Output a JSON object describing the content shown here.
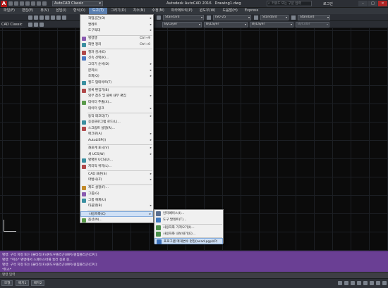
{
  "titlebar": {
    "workspace": "AutoCAD Classic",
    "app_name": "Autodesk AutoCAD 2016",
    "document": "Drawing1.dwg",
    "search_placeholder": "키워드 또는 구문 입력",
    "login": "로그인"
  },
  "menubar": [
    "파일(F)",
    "편집(E)",
    "뷰(V)",
    "삽입(I)",
    "형식(O)",
    "도구(T)",
    "그리기(D)",
    "치수(N)",
    "수정(M)",
    "파라메트릭(P)",
    "윈도우(W)",
    "도움말(H)",
    "Express"
  ],
  "toolbar": {
    "workspace_short": "CAD Classic",
    "text_style": "Standard",
    "dim_style": "ISO-25",
    "table_style": "Standard",
    "mleader_style": "Standard",
    "layer_color": "ByLayer",
    "linetype": "ByLayer",
    "lineweight": "ByLayer",
    "plot_style": "ByColor"
  },
  "tools_menu": {
    "items": [
      {
        "label": "작업공간(O)",
        "shortcut": "",
        "arrow": true,
        "icon": "none"
      },
      {
        "label": "팔레트",
        "shortcut": "",
        "arrow": true,
        "icon": "none"
      },
      {
        "label": "도구막대",
        "shortcut": "",
        "arrow": true,
        "icon": "none"
      },
      {
        "label": "명령행",
        "shortcut": "Ctrl+9",
        "arrow": false,
        "icon": "command-line-icon"
      },
      {
        "label": "화면 정리",
        "shortcut": "Ctrl+0",
        "arrow": false,
        "icon": "clean-screen-icon"
      },
      {
        "label": "철자 검사(E)",
        "shortcut": "",
        "arrow": false,
        "icon": "spell-check-icon"
      },
      {
        "label": "신속 선택(K)...",
        "shortcut": "",
        "arrow": false,
        "icon": "quick-select-icon"
      },
      {
        "label": "그리기 순서(D)",
        "shortcut": "",
        "arrow": true,
        "icon": "none"
      },
      {
        "label": "분리(I)",
        "shortcut": "",
        "arrow": true,
        "icon": "none"
      },
      {
        "label": "조회(Q)",
        "shortcut": "",
        "arrow": true,
        "icon": "none"
      },
      {
        "label": "필드 업데이트(T)",
        "shortcut": "",
        "arrow": false,
        "icon": "field-update-icon"
      },
      {
        "label": "블록 편집기(B)",
        "shortcut": "",
        "arrow": false,
        "icon": "block-editor-icon"
      },
      {
        "label": "외부 참조 및 블록 내부 편집",
        "shortcut": "",
        "arrow": true,
        "icon": "none"
      },
      {
        "label": "데이터 추출(X)...",
        "shortcut": "",
        "arrow": false,
        "icon": "data-extraction-icon"
      },
      {
        "label": "데이터 링크",
        "shortcut": "",
        "arrow": true,
        "icon": "none"
      },
      {
        "label": "동작 레코더(T)",
        "shortcut": "",
        "arrow": true,
        "icon": "none"
      },
      {
        "label": "응용프로그램 로드(L)...",
        "shortcut": "",
        "arrow": false,
        "icon": "app-load-icon"
      },
      {
        "label": "스크립트 실행(R)...",
        "shortcut": "",
        "arrow": false,
        "icon": "run-script-icon"
      },
      {
        "label": "매크로(A)",
        "shortcut": "",
        "arrow": true,
        "icon": "none"
      },
      {
        "label": "AutoLISP(I)",
        "shortcut": "",
        "arrow": true,
        "icon": "none"
      },
      {
        "label": "좌표계 표시(V)",
        "shortcut": "",
        "arrow": true,
        "icon": "none"
      },
      {
        "label": "새 UCS(W)",
        "shortcut": "",
        "arrow": true,
        "icon": "none"
      },
      {
        "label": "명명된 UCS(U)...",
        "shortcut": "",
        "arrow": false,
        "icon": "named-ucs-icon"
      },
      {
        "label": "지리적 위치(L)...",
        "shortcut": "",
        "arrow": false,
        "icon": "geolocation-icon"
      },
      {
        "label": "CAD 표준(S)",
        "shortcut": "",
        "arrow": true,
        "icon": "none"
      },
      {
        "label": "마법사(Z)",
        "shortcut": "",
        "arrow": true,
        "icon": "none"
      },
      {
        "label": "제도 설정(F)...",
        "shortcut": "",
        "arrow": false,
        "icon": "drafting-settings-icon"
      },
      {
        "label": "그룹(G)",
        "shortcut": "",
        "arrow": false,
        "icon": "group-icon"
      },
      {
        "label": "그룹 해제(U)",
        "shortcut": "",
        "arrow": false,
        "icon": "ungroup-icon"
      },
      {
        "label": "타블렛(B)",
        "shortcut": "",
        "arrow": true,
        "icon": "none"
      },
      {
        "label": "사용자화(C)",
        "shortcut": "",
        "arrow": true,
        "icon": "none",
        "highlight": true
      },
      {
        "label": "옵션(N)...",
        "shortcut": "",
        "arrow": false,
        "icon": "options-icon"
      }
    ]
  },
  "customize_submenu": {
    "items": [
      {
        "label": "인터페이스(I)...",
        "icon": "interface-icon"
      },
      {
        "label": "도구 팔레트(T)...",
        "icon": "tool-palettes-icon"
      },
      {
        "label": "사용자화 가져오기(I)...",
        "icon": "import-customizations-icon"
      },
      {
        "label": "사용자화 내보내기(E)...",
        "icon": "export-customizations-icon"
      },
      {
        "label": "프로그램 매개변수 편집(acad.pgp)(P)",
        "icon": "edit-pgp-icon",
        "highlight": true
      }
    ]
  },
  "command": {
    "lines": [
      "명령: 구석 지정 또는 [울타리(F)/윈도우폴리곤(WP)/걸침폴리곤(CP)]:",
      "명령: *취소* 명령에서 스페이스바를 눌러 종료 중...",
      "명령: 구석 지정 또는 [울타리(F)/윈도우폴리곤(WP)/걸침폴리곤(CP)]:",
      "*취소*"
    ],
    "input_placeholder": "명령 입력"
  },
  "status": {
    "tabs": [
      "모형",
      "배치1",
      "배치2"
    ]
  },
  "colors": {
    "menu_highlight": "#cfe0f5",
    "command_bg": "#6a3f94",
    "drawing_bg": "#0b0b0b"
  }
}
